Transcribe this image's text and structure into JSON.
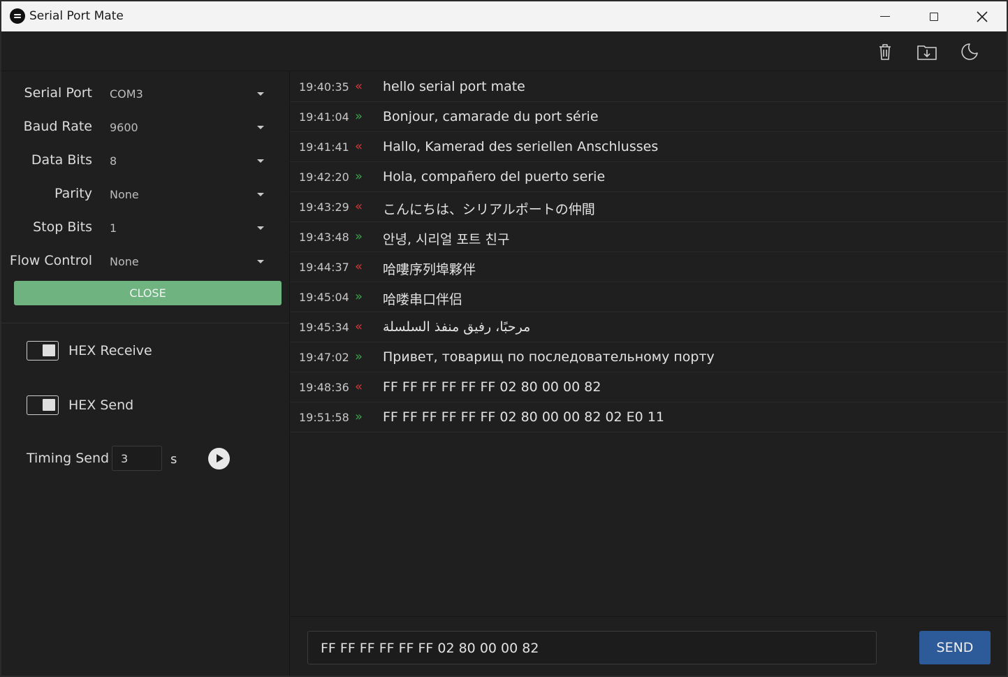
{
  "window": {
    "title": "Serial Port Mate"
  },
  "toolbar": {
    "icons": [
      "trash-icon",
      "export-icon",
      "moon-icon"
    ]
  },
  "settings": {
    "fields": [
      {
        "label": "Serial Port",
        "value": "COM3"
      },
      {
        "label": "Baud Rate",
        "value": "9600"
      },
      {
        "label": "Data Bits",
        "value": "8"
      },
      {
        "label": "Parity",
        "value": "None"
      },
      {
        "label": "Stop Bits",
        "value": "1"
      },
      {
        "label": "Flow Control",
        "value": "None"
      }
    ],
    "close_label": "CLOSE",
    "hex_receive_label": "HEX Receive",
    "hex_send_label": "HEX Send",
    "timing_label": "Timing Send",
    "timing_value": "3",
    "timing_unit": "s"
  },
  "log": [
    {
      "time": "19:40:35",
      "dir": "rx",
      "text": "hello serial port mate"
    },
    {
      "time": "19:41:04",
      "dir": "tx",
      "text": "Bonjour, camarade du port série"
    },
    {
      "time": "19:41:41",
      "dir": "rx",
      "text": "Hallo, Kamerad des seriellen Anschlusses"
    },
    {
      "time": "19:42:20",
      "dir": "tx",
      "text": "Hola, compañero del puerto serie"
    },
    {
      "time": "19:43:29",
      "dir": "rx",
      "text": "こんにちは、シリアルポートの仲間"
    },
    {
      "time": "19:43:48",
      "dir": "tx",
      "text": "안녕, 시리얼 포트 친구"
    },
    {
      "time": "19:44:37",
      "dir": "rx",
      "text": "哈嘍序列埠夥伴"
    },
    {
      "time": "19:45:04",
      "dir": "tx",
      "text": "哈喽串口伴侣"
    },
    {
      "time": "19:45:34",
      "dir": "rx",
      "text": "مرحبًا، رفيق منفذ السلسلة"
    },
    {
      "time": "19:47:02",
      "dir": "tx",
      "text": "Привет, товарищ по последовательному порту"
    },
    {
      "time": "19:48:36",
      "dir": "rx",
      "text": "FF FF FF FF FF FF 02 80 00 00 82"
    },
    {
      "time": "19:51:58",
      "dir": "tx",
      "text": "FF FF FF FF FF FF 02 80 00 00 82 02 E0 11"
    }
  ],
  "direction_glyphs": {
    "rx": "«",
    "tx": "»"
  },
  "colors": {
    "rx_arrow": "#d33a3a",
    "tx_arrow": "#3fa44c",
    "close_button": "#6fb381",
    "send_button": "#2d5a98"
  },
  "send": {
    "input_value": "FF FF FF FF FF FF 02 80 00 00 82",
    "button_label": "SEND"
  }
}
